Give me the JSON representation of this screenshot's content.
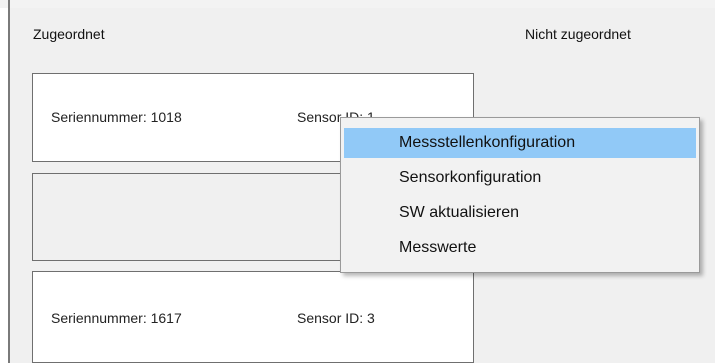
{
  "columns": {
    "assigned_label": "Zugeordnet",
    "unassigned_label": "Nicht zugeordnet"
  },
  "cards": [
    {
      "serial": "Seriennummer: 1018",
      "sensor": "Sensor ID: 1"
    },
    {
      "serial": "",
      "sensor": ""
    },
    {
      "serial": "Seriennummer: 1617",
      "sensor": "Sensor ID: 3"
    }
  ],
  "context_menu": {
    "items": [
      {
        "label": "Messstellenkonfiguration",
        "highlighted": true
      },
      {
        "label": "Sensorkonfiguration",
        "highlighted": false
      },
      {
        "label": "SW aktualisieren",
        "highlighted": false
      },
      {
        "label": "Messwerte",
        "highlighted": false
      }
    ]
  },
  "colors": {
    "highlight": "#91c9f7",
    "panel_background": "#f0f0f0"
  }
}
